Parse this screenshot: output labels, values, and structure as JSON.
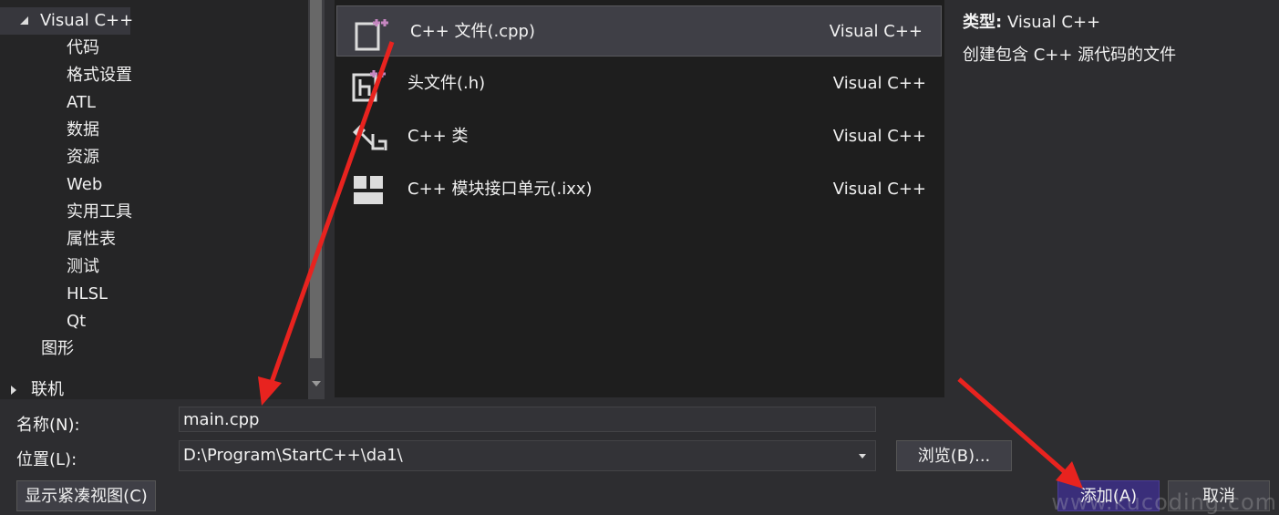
{
  "tree": {
    "root_label": "Visual C++",
    "children": [
      "代码",
      "格式设置",
      "ATL",
      "数据",
      "资源",
      "Web",
      "实用工具",
      "属性表",
      "测试",
      "HLSL",
      "Qt"
    ],
    "sibling": "图形",
    "collapsed": "联机"
  },
  "templates": [
    {
      "name": "C++ 文件(.cpp)",
      "lang": "Visual C++",
      "icon": "cpp-file-icon"
    },
    {
      "name": "头文件(.h)",
      "lang": "Visual C++",
      "icon": "header-file-icon"
    },
    {
      "name": "C++ 类",
      "lang": "Visual C++",
      "icon": "cpp-class-icon"
    },
    {
      "name": "C++ 模块接口单元(.ixx)",
      "lang": "Visual C++",
      "icon": "module-unit-icon"
    }
  ],
  "description": {
    "type_label": "类型:",
    "type_value": "Visual C++",
    "text": "创建包含 C++ 源代码的文件"
  },
  "form": {
    "name_label": "名称(N):",
    "name_value": "main.cpp",
    "location_label": "位置(L):",
    "location_value": "D:\\Program\\StartC++\\da1\\",
    "browse_label": "浏览(B)...",
    "compact_view_label": "显示紧凑视图(C)",
    "add_label": "添加(A)",
    "cancel_label": "取消"
  },
  "watermark": "www.kucoding.com",
  "colors": {
    "accent": "#3a2e7a",
    "annotation_arrow": "#e8231f",
    "icon_purple": "#c586c0"
  }
}
